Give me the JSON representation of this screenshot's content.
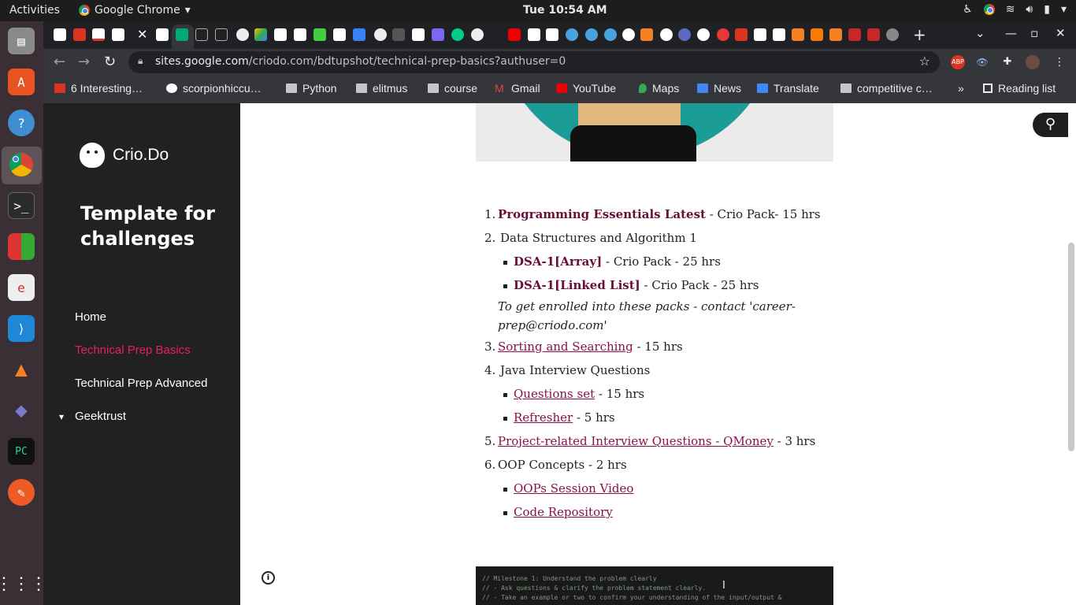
{
  "system": {
    "activities": "Activities",
    "app_name": "Google Chrome",
    "clock": "Tue 10:54 AM"
  },
  "browser": {
    "url_host": "sites.google.com",
    "url_path": "/criodo.com/bdtupshot/technical-prep-basics?authuser=0",
    "bookmarks": [
      "6 Interesting…",
      "scorpionhiccu…",
      "Python",
      "elitmus",
      "course",
      "Gmail",
      "YouTube",
      "Maps",
      "News",
      "Translate",
      "competitive c…"
    ],
    "reading_list": "Reading list"
  },
  "sidebar": {
    "brand": "Crio.Do",
    "site_title": "Template for challenges",
    "nav": [
      "Home",
      "Technical Prep Basics",
      "Technical Prep Advanced",
      "Geektrust"
    ]
  },
  "content": {
    "items": [
      {
        "num": "1.",
        "link": "Programming Essentials Latest",
        "rest": " - Crio Pack- 15 hrs"
      },
      {
        "num": "2.",
        "text": " Data Structures and Algorithm 1"
      },
      {
        "link": "DSA-1[Array]",
        "rest": " - Crio Pack - 25 hrs"
      },
      {
        "link": "DSA-1[Linked List]",
        "rest": " - Crio Pack - 25 hrs"
      },
      {
        "note": "To get enrolled into these packs - contact 'career-prep@criodo.com'"
      },
      {
        "num": "3.",
        "link": "Sorting and Searching",
        "rest": " - 15 hrs"
      },
      {
        "num": "4.",
        "text": " Java Interview Questions"
      },
      {
        "link": "Questions set",
        "rest": " - 15 hrs"
      },
      {
        "link": "Refresher",
        "rest": " - 5 hrs"
      },
      {
        "num": "5.",
        "link": "Project-related Interview Questions - QMoney",
        "rest": " - 3 hrs"
      },
      {
        "num": "6.",
        "text": "OOP Concepts - 2 hrs"
      },
      {
        "link": "OOPs Session Video"
      },
      {
        "link": "Code Repository"
      }
    ],
    "code_lines": [
      "// Milestone 1: Understand the problem clearly",
      "// - Ask questions & clarify the problem statement clearly.",
      "// - Take an example or two to confirm your understanding of the input/output &"
    ]
  }
}
